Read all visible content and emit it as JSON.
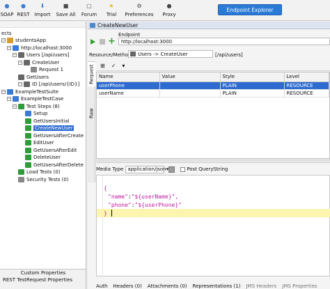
{
  "toolbar": {
    "items": [
      {
        "label": "SOAP",
        "color": "#3a7bd5",
        "glyph": "●",
        "name": "soap-icon"
      },
      {
        "label": "REST",
        "color": "#3a7bd5",
        "glyph": "●",
        "name": "rest-icon"
      },
      {
        "label": "Import",
        "color": "#3a7bd5",
        "glyph": "⬇",
        "name": "import-icon"
      },
      {
        "label": "Save All",
        "color": "#4a4a4a",
        "glyph": "■",
        "name": "save-icon"
      },
      {
        "label": "Forum",
        "color": "#4a4a4a",
        "glyph": "▢",
        "name": "forum-icon"
      },
      {
        "label": "Trial",
        "color": "#e6b800",
        "glyph": "★",
        "name": "trial-icon"
      },
      {
        "label": "Preferences",
        "color": "#4a4a4a",
        "glyph": "⚙",
        "name": "gear-icon"
      },
      {
        "label": "Proxy",
        "color": "#444444",
        "glyph": "●",
        "name": "proxy-icon"
      }
    ],
    "endpoint_explorer": "Endpoint Explorer"
  },
  "navigator": {
    "heading": "ects",
    "tree": [
      {
        "label": "studentsApp",
        "icon": "project",
        "color": "#d99b2b"
      },
      {
        "label": "http://localhost:3000",
        "icon": "service",
        "color": "#3a7bd5"
      },
      {
        "label": "Users [/api/users]",
        "icon": "resource",
        "color": "#666666"
      },
      {
        "label": "CreateUser",
        "icon": "method",
        "color": "#666666"
      },
      {
        "label": "Request 1",
        "icon": "request",
        "color": "#888888"
      },
      {
        "label": "GetUsers",
        "icon": "method",
        "color": "#666666"
      },
      {
        "label": "ID [/api/users/{ID}]",
        "icon": "resource",
        "color": "#666666"
      },
      {
        "label": "ExampleTestSuite",
        "icon": "suite",
        "color": "#3a7bd5"
      },
      {
        "label": "ExampleTestCase",
        "icon": "case",
        "color": "#3a7bd5"
      },
      {
        "label": "Test Steps (8)",
        "icon": "steps",
        "color": "#2f9c3a"
      },
      {
        "label": "Setup",
        "icon": "star",
        "color": "#3a7bd5"
      },
      {
        "label": "GetUsersInitial",
        "icon": "step",
        "color": "#2f9c3a"
      },
      {
        "label": "CreateNewUser",
        "icon": "step",
        "color": "#2f9c3a"
      },
      {
        "label": "GetUsersAfterCreate",
        "icon": "step",
        "color": "#2f9c3a"
      },
      {
        "label": "EditUser",
        "icon": "step",
        "color": "#2f9c3a"
      },
      {
        "label": "GetUsersAfterEdit",
        "icon": "step",
        "color": "#2f9c3a"
      },
      {
        "label": "DeleteUser",
        "icon": "step",
        "color": "#2f9c3a"
      },
      {
        "label": "GetUsersAfterDelete",
        "icon": "step",
        "color": "#2f9c3a"
      },
      {
        "label": "Load Tests (0)",
        "icon": "load",
        "color": "#2f9c3a"
      },
      {
        "label": "Security Tests (0)",
        "icon": "security",
        "color": "#888888"
      }
    ],
    "bottom": [
      "Custom Properties",
      "REST TestRequest Properties"
    ]
  },
  "request": {
    "title": "CreateNewUser",
    "endpoint_label": "Endpoint",
    "endpoint_value": "http://localhost:3000",
    "resource_label": "Resource/Method:",
    "resource_value": "Users -> CreateUser",
    "resource_path": "[/api/users]",
    "side_tabs": [
      "Request",
      "Raw"
    ],
    "params": {
      "columns": [
        "Name",
        "Value",
        "Style",
        "Level"
      ],
      "rows": [
        {
          "name": "userPhone",
          "value": "",
          "style": "PLAIN",
          "level": "RESOURCE"
        },
        {
          "name": "userName",
          "value": "",
          "style": "PLAIN",
          "level": "RESOURCE"
        }
      ]
    },
    "media_type_label": "Media Type",
    "media_type_value": "application/json",
    "post_query_label": "Post QueryString",
    "body": {
      "line1": "{",
      "line2_key": "\"name\"",
      "line2_sep": ":",
      "line2_val": "\"${userName}\",",
      "line3_key": "\"phone\"",
      "line3_sep": ":",
      "line3_val": "\"${userPhone}\"",
      "line4": "}"
    },
    "bottom_tabs": [
      "Auth",
      "Headers (0)",
      "Attachments (0)",
      "Representations (1)",
      "JMS Headers",
      "JMS Properties"
    ]
  }
}
